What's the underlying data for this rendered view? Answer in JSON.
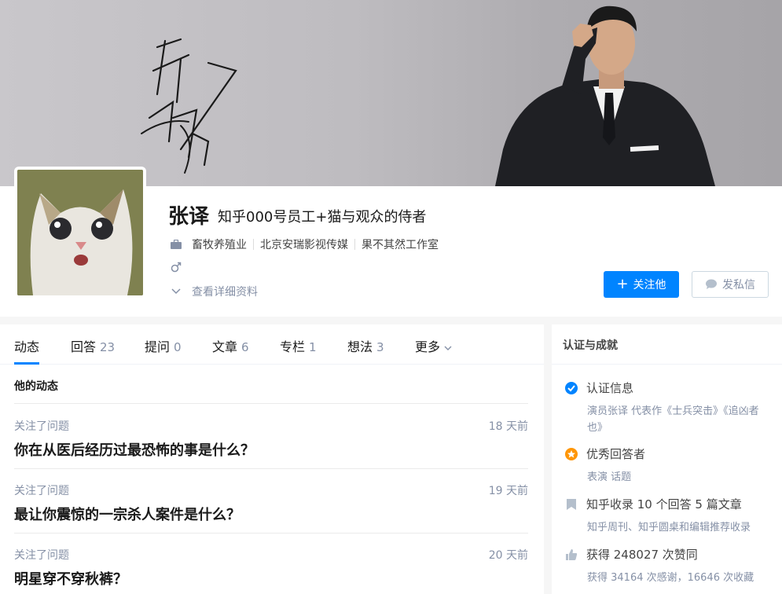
{
  "cover": {
    "signature_text": "张译",
    "colors": {
      "background": "#bebcc0",
      "suit": "#1f2024"
    }
  },
  "profile": {
    "name": "张译",
    "headline": "知乎000号员工+猫与观众的侍者",
    "industry": "畜牧养殖业",
    "companies": [
      "北京安瑞影视传媒",
      "果不其然工作室"
    ],
    "gender_icon": "male-icon",
    "details_link": "查看详细资料",
    "follow_button": "关注他",
    "message_button": "发私信"
  },
  "tabs": [
    {
      "label": "动态",
      "count": ""
    },
    {
      "label": "回答",
      "count": "23"
    },
    {
      "label": "提问",
      "count": "0"
    },
    {
      "label": "文章",
      "count": "6"
    },
    {
      "label": "专栏",
      "count": "1"
    },
    {
      "label": "想法",
      "count": "3"
    },
    {
      "label": "更多",
      "count": ""
    }
  ],
  "feed": {
    "section_title": "他的动态",
    "items": [
      {
        "action": "关注了问题",
        "time": "18 天前",
        "title": "你在从医后经历过最恐怖的事是什么？"
      },
      {
        "action": "关注了问题",
        "time": "19 天前",
        "title": "最让你震惊的一宗杀人案件是什么？"
      },
      {
        "action": "关注了问题",
        "time": "20 天前",
        "title": "明星穿不穿秋裤？"
      }
    ]
  },
  "sidebar": {
    "title": "认证与成就",
    "items": [
      {
        "icon": "verified-icon",
        "label": "认证信息",
        "sub": "演员张译 代表作《士兵突击》《追凶者也》"
      },
      {
        "icon": "star-badge-icon",
        "label": "优秀回答者",
        "sub": "表演 话题"
      },
      {
        "icon": "bookmark-icon",
        "label": "知乎收录 10 个回答 5 篇文章",
        "sub": "知乎周刊、知乎圆桌和编辑推荐收录"
      },
      {
        "icon": "thumbs-up-icon",
        "label": "获得 248027 次赞同",
        "sub": "获得 34164 次感谢，16646 次收藏"
      }
    ]
  },
  "colors": {
    "accent": "#0084ff",
    "muted": "#8590a6",
    "verified": "#0084ff",
    "badge": "#ff9607"
  }
}
